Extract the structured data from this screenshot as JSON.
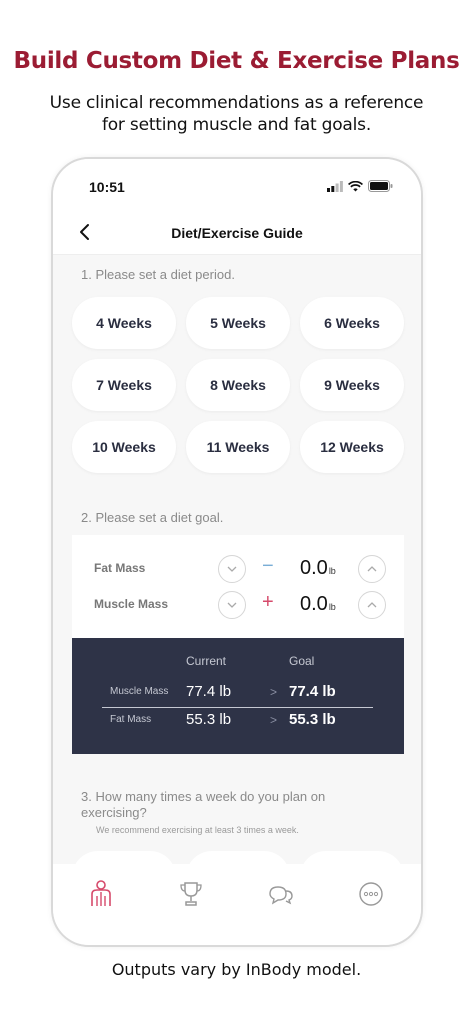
{
  "promo": {
    "title": "Build Custom Diet & Exercise Plans",
    "subtitle": "Use clinical recommendations as a reference for setting muscle and fat goals.",
    "footer": "Outputs vary by InBody model."
  },
  "status_bar": {
    "time": "10:51",
    "icons": [
      "signal-icon",
      "wifi-icon",
      "battery-icon"
    ]
  },
  "nav": {
    "title": "Diet/Exercise Guide",
    "back_icon": "chevron-left-icon"
  },
  "period": {
    "label": "1. Please set a diet period.",
    "options": [
      "4 Weeks",
      "5 Weeks",
      "6 Weeks",
      "7 Weeks",
      "8 Weeks",
      "9 Weeks",
      "10 Weeks",
      "11 Weeks",
      "12 Weeks"
    ]
  },
  "goal": {
    "label": "2. Please set a diet goal.",
    "rows": [
      {
        "name": "Fat Mass",
        "sign": "−",
        "value": "0.0",
        "unit": "lb"
      },
      {
        "name": "Muscle Mass",
        "sign": "+",
        "value": "0.0",
        "unit": "lb"
      }
    ]
  },
  "summary": {
    "col_current": "Current",
    "col_goal": "Goal",
    "arrow": ">",
    "rows": [
      {
        "label": "Muscle Mass",
        "current": "77.4 lb",
        "goal": "77.4 lb"
      },
      {
        "label": "Fat Mass",
        "current": "55.3 lb",
        "goal": "55.3 lb"
      }
    ]
  },
  "exercise": {
    "label": "3. How many times a week do you plan on exercising?",
    "hint": "We recommend exercising at least 3 times a week."
  },
  "tabs": [
    "body-icon",
    "trophy-icon",
    "chat-icon",
    "more-icon"
  ],
  "colors": {
    "accent": "#9b1c33",
    "summary_bg": "#2e3347",
    "tab_active": "#d64a6b"
  }
}
